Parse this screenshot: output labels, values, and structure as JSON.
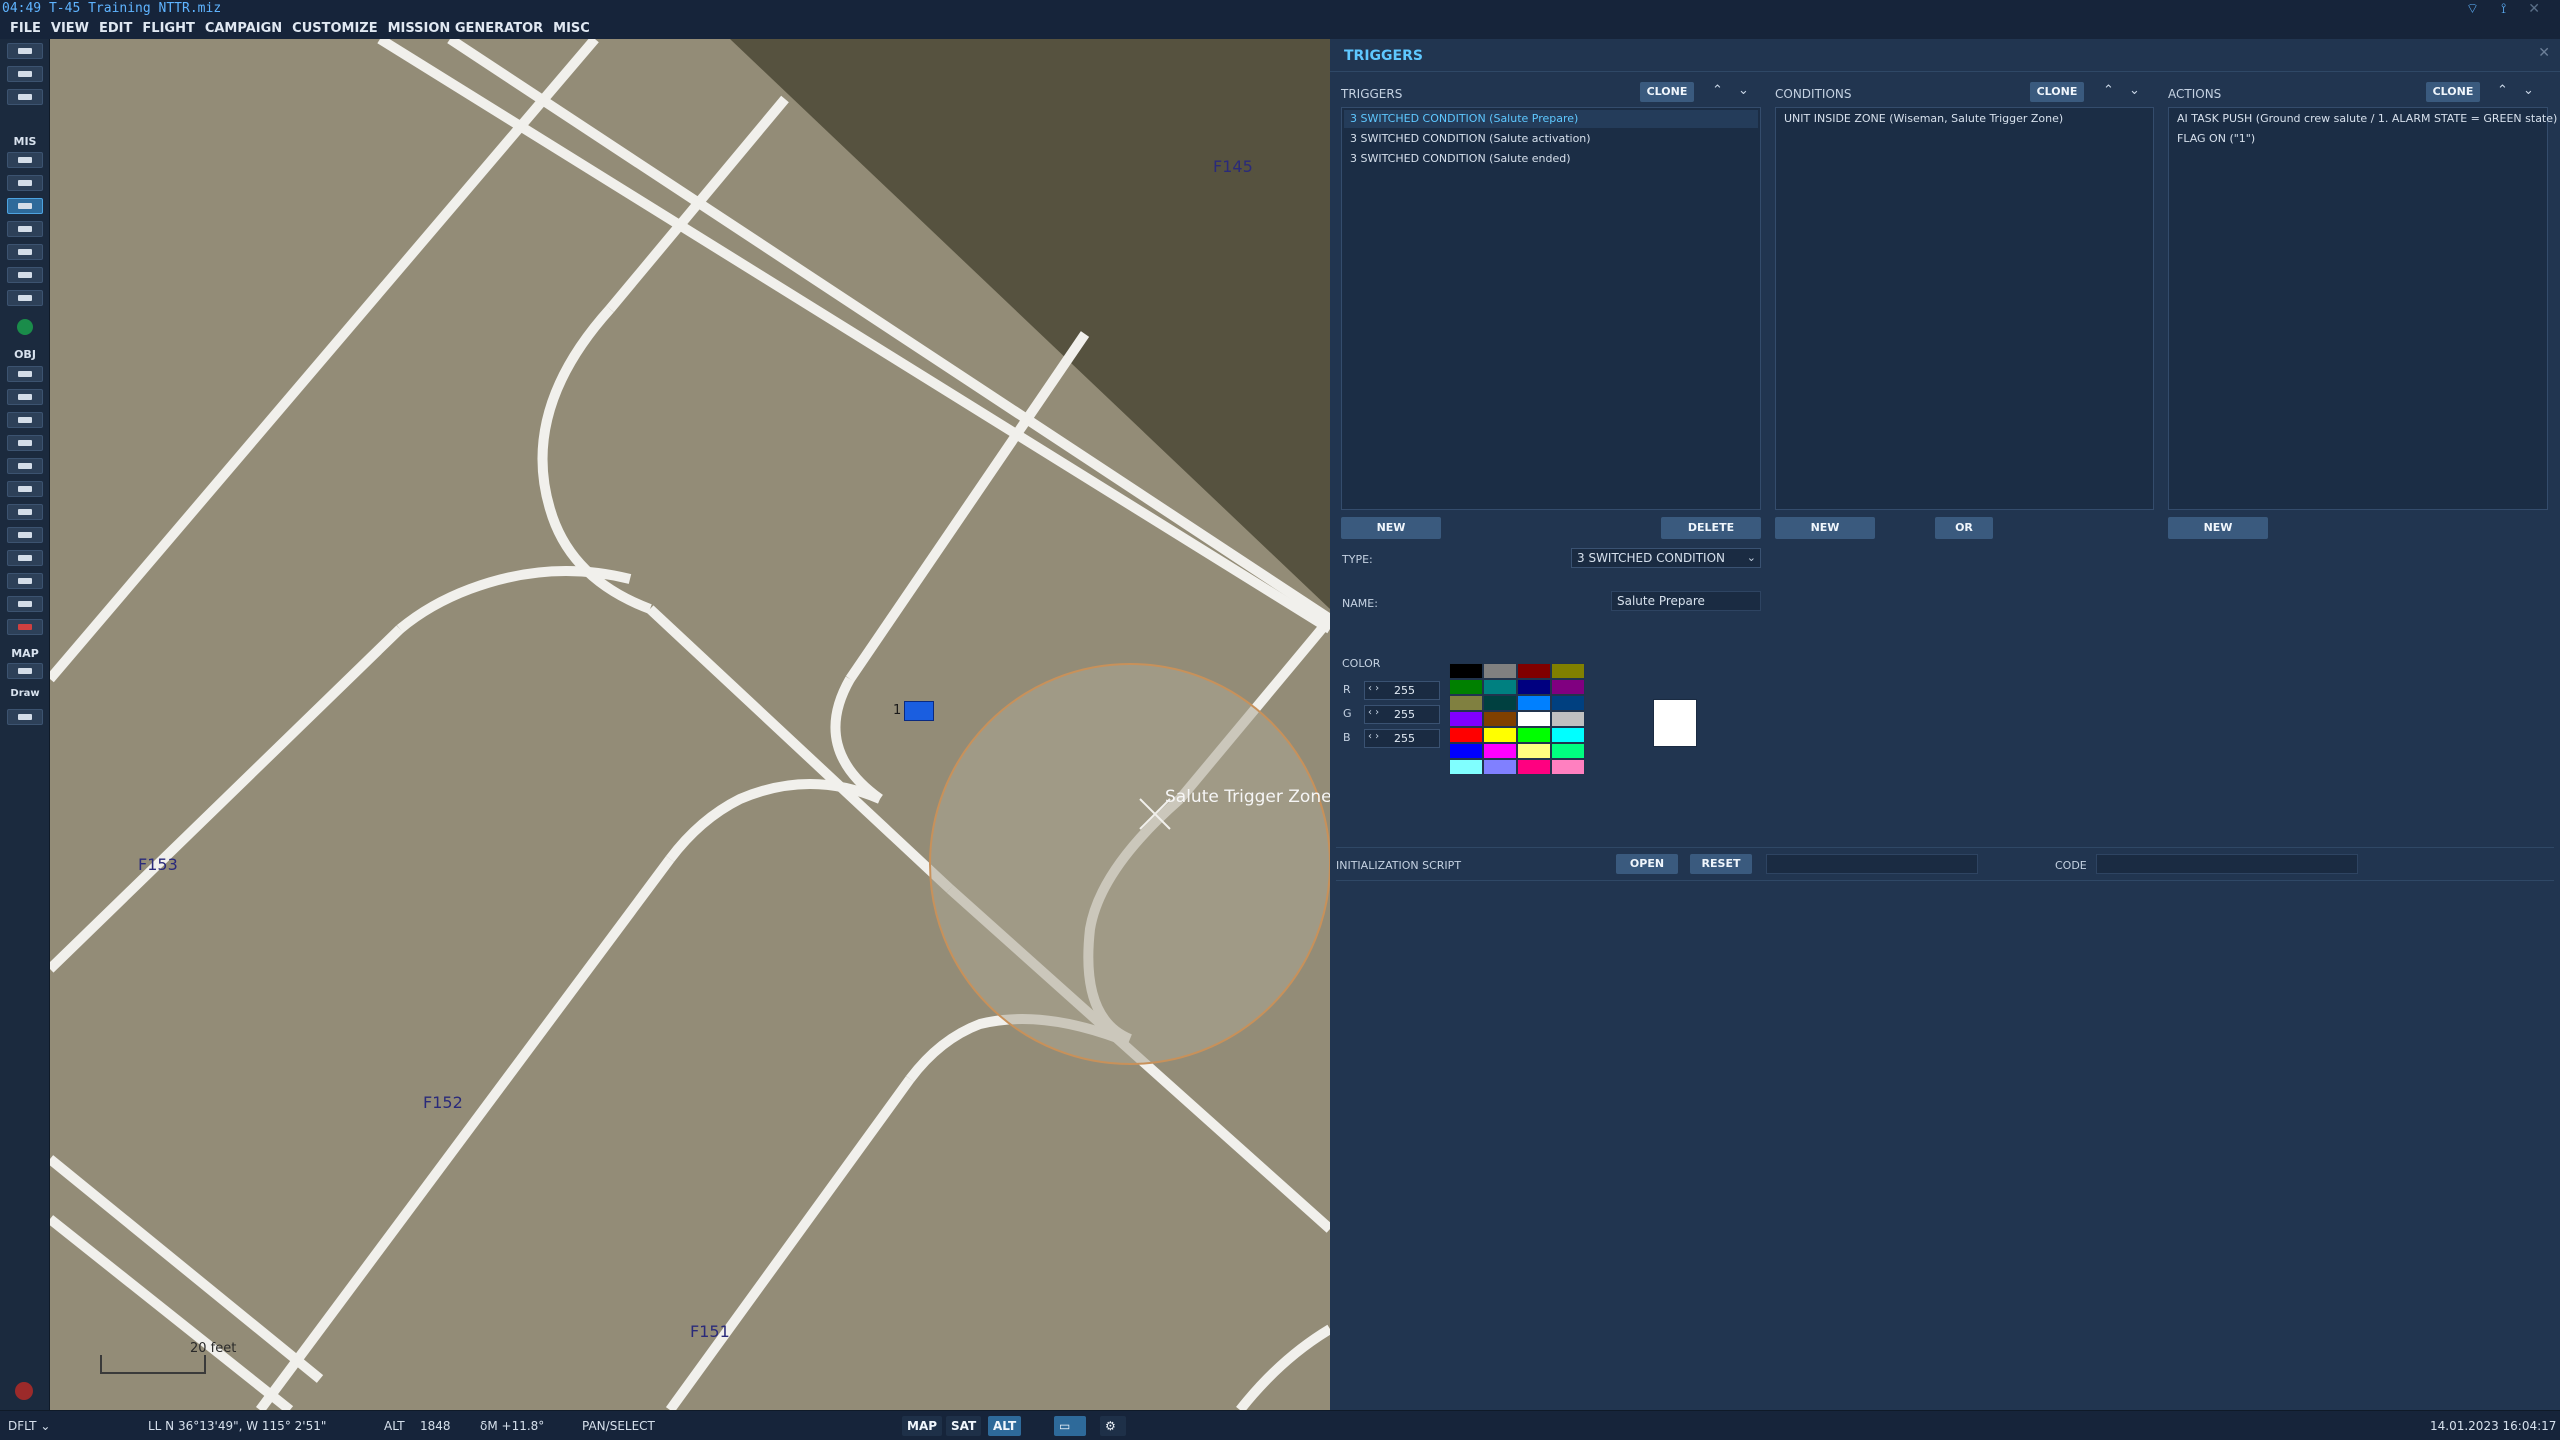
{
  "window": {
    "title": "04:49  T-45 Training NTTR.miz",
    "clock_icon": "clock-icon",
    "wifi_icon": "wifi-icon",
    "tower_icon": "radio-tower-icon",
    "close_symbol": "✕"
  },
  "menu": [
    "FILE",
    "VIEW",
    "EDIT",
    "FLIGHT",
    "CAMPAIGN",
    "CUSTOMIZE",
    "MISSION GENERATOR",
    "MISC"
  ],
  "toolbar": {
    "sections": [
      "MIS",
      "OBJ",
      "MAP"
    ],
    "draw_label": "Draw"
  },
  "map": {
    "labels": [
      "F145",
      "F153",
      "F152",
      "F151"
    ],
    "zone_name": "Salute Trigger Zone",
    "unit_number": "1",
    "scale_label": "20 feet",
    "colors": {
      "ground": "#938c77",
      "terrain_dark": "#56523f",
      "taxiway": "#f1f0ec",
      "zone_fill": "#aca694",
      "zone_edge": "#c8915a"
    }
  },
  "panel": {
    "title": "TRIGGERS",
    "triggers": {
      "header": "TRIGGERS",
      "clone": "CLONE",
      "items": [
        "3 SWITCHED CONDITION (Salute Prepare)",
        "3 SWITCHED CONDITION (Salute activation)",
        "3 SWITCHED CONDITION (Salute ended)"
      ],
      "selected_index": 0,
      "new": "NEW",
      "delete": "DELETE"
    },
    "conditions": {
      "header": "CONDITIONS",
      "clone": "CLONE",
      "items": [
        "UNIT INSIDE ZONE (Wiseman, Salute Trigger Zone)"
      ],
      "new": "NEW",
      "or": "OR"
    },
    "actions": {
      "header": "ACTIONS",
      "clone": "CLONE",
      "items": [
        "AI TASK PUSH (Ground crew salute / 1. ALARM STATE = GREEN state)",
        "FLAG ON (\"1\")"
      ],
      "new": "NEW"
    },
    "type_label": "TYPE:",
    "type_value": "3 SWITCHED CONDITION",
    "name_label": "NAME:",
    "name_value": "Salute Prepare",
    "color": {
      "label": "COLOR",
      "r_label": "R",
      "r": "255",
      "g_label": "G",
      "g": "255",
      "b_label": "B",
      "b": "255",
      "preview": "#ffffff",
      "swatches": [
        "#000000",
        "#808080",
        "#800000",
        "#808000",
        "#008000",
        "#008080",
        "#000080",
        "#800080",
        "#808040",
        "#004040",
        "#0080ff",
        "#004080",
        "#8000ff",
        "#804000",
        "#ffffff",
        "#c0c0c0",
        "#ff0000",
        "#ffff00",
        "#00ff00",
        "#00ffff",
        "#0000ff",
        "#ff00ff",
        "#ffff80",
        "#00ff80",
        "#80ffff",
        "#8080ff",
        "#ff0080",
        "#ff80c0"
      ]
    },
    "init_script": {
      "label": "INITIALIZATION SCRIPT",
      "open": "OPEN",
      "reset": "RESET",
      "code_label": "CODE"
    }
  },
  "status": {
    "profile": "DFLT",
    "coords": "LL   N 36°13'49\", W 115° 2'51\"",
    "alt_label": "ALT",
    "alt_value": "1848",
    "dm": "δM  +11.8°",
    "mode": "PAN/SELECT",
    "map_btn": "MAP",
    "sat_btn": "SAT",
    "alt_btn": "ALT",
    "datetime": "14.01.2023 16:04:17"
  }
}
